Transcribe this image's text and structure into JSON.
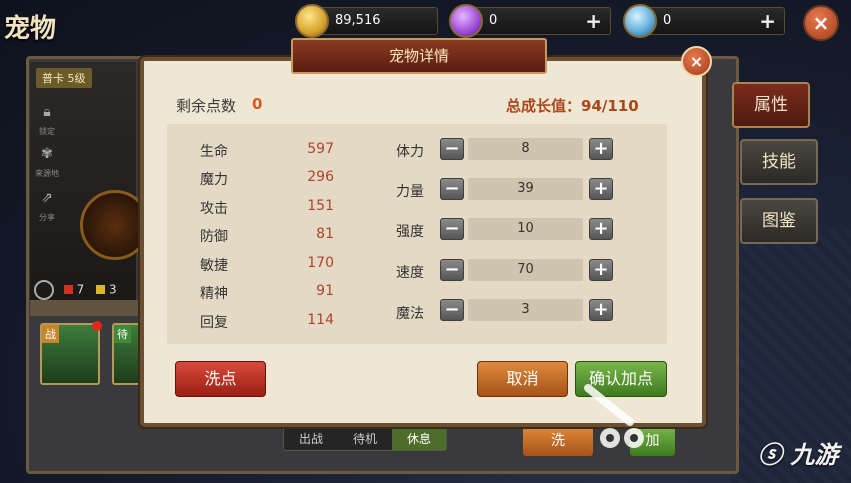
{
  "page_title": "宠物",
  "resources": {
    "gold": {
      "value": "89,516",
      "icon": "gold-coin-icon"
    },
    "crystal": {
      "value": "0",
      "icon": "purple-crystal-icon",
      "plus": "+"
    },
    "diamond": {
      "value": "0",
      "icon": "diamond-icon",
      "plus": "+"
    },
    "close": "×"
  },
  "background_panel": {
    "level_tag": "普卡 5级",
    "side_items": [
      {
        "icon": "lock-icon",
        "label": "锁定"
      },
      {
        "icon": "paw-icon",
        "label": "来源地"
      },
      {
        "icon": "share-icon",
        "label": "分享"
      }
    ],
    "red_count": "7",
    "yellow_count": "3",
    "pet_tags": [
      "战",
      "待"
    ],
    "right_tabs": [
      "属性",
      "技能",
      "图鉴"
    ],
    "status_tabs": [
      "出战",
      "待机",
      "休息"
    ],
    "bottom_buttons": [
      "洗",
      "加"
    ]
  },
  "dialog": {
    "title": "宠物详情",
    "close": "×",
    "remaining_points_label": "剩余点数",
    "remaining_points_value": "0",
    "growth_label": "总成长值：94/110",
    "attributes": [
      {
        "name": "生命",
        "value": "597"
      },
      {
        "name": "魔力",
        "value": "296"
      },
      {
        "name": "攻击",
        "value": "151"
      },
      {
        "name": "防御",
        "value": "81"
      },
      {
        "name": "敏捷",
        "value": "170"
      },
      {
        "name": "精神",
        "value": "91"
      },
      {
        "name": "回复",
        "value": "114"
      }
    ],
    "allocations": [
      {
        "name": "体力",
        "value": "8"
      },
      {
        "name": "力量",
        "value": "39"
      },
      {
        "name": "强度",
        "value": "10"
      },
      {
        "name": "速度",
        "value": "70"
      },
      {
        "name": "魔法",
        "value": "3"
      }
    ],
    "minus": "−",
    "plus": "+",
    "buttons": {
      "reset": "洗点",
      "cancel": "取消",
      "confirm": "确认加点"
    }
  },
  "watermark": "九游",
  "colors": {
    "accent_red": "#b0432d",
    "dialog_bg": "#efe6d3",
    "frame": "#6a4f33"
  }
}
